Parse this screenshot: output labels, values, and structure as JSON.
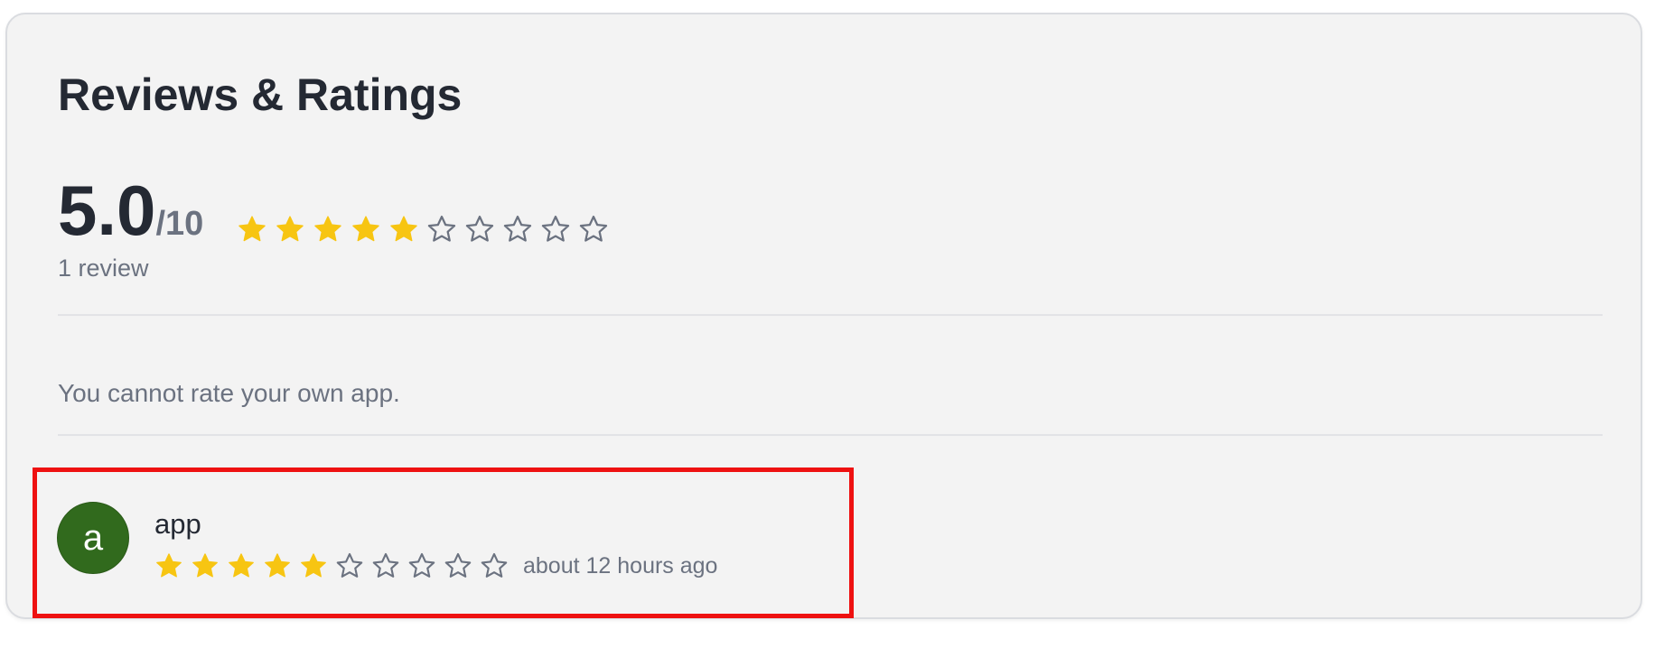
{
  "section": {
    "title": "Reviews & Ratings"
  },
  "summary": {
    "score": "5.0",
    "score_max": "/10",
    "rating_value": 5,
    "rating_max": 10,
    "review_count": "1 review"
  },
  "notice": "You cannot rate your own app.",
  "reviews": [
    {
      "avatar_initial": "a",
      "name": "app",
      "rating_value": 5,
      "rating_max": 10,
      "time_ago": "about 12 hours ago",
      "highlighted": true
    }
  ],
  "colors": {
    "star_filled": "#f7c512",
    "star_empty_stroke": "#6b7280",
    "avatar_bg": "#316a1d",
    "highlight_border": "#ee1111"
  },
  "icons": {
    "star_filled": "star-filled-icon",
    "star_empty": "star-empty-icon"
  }
}
